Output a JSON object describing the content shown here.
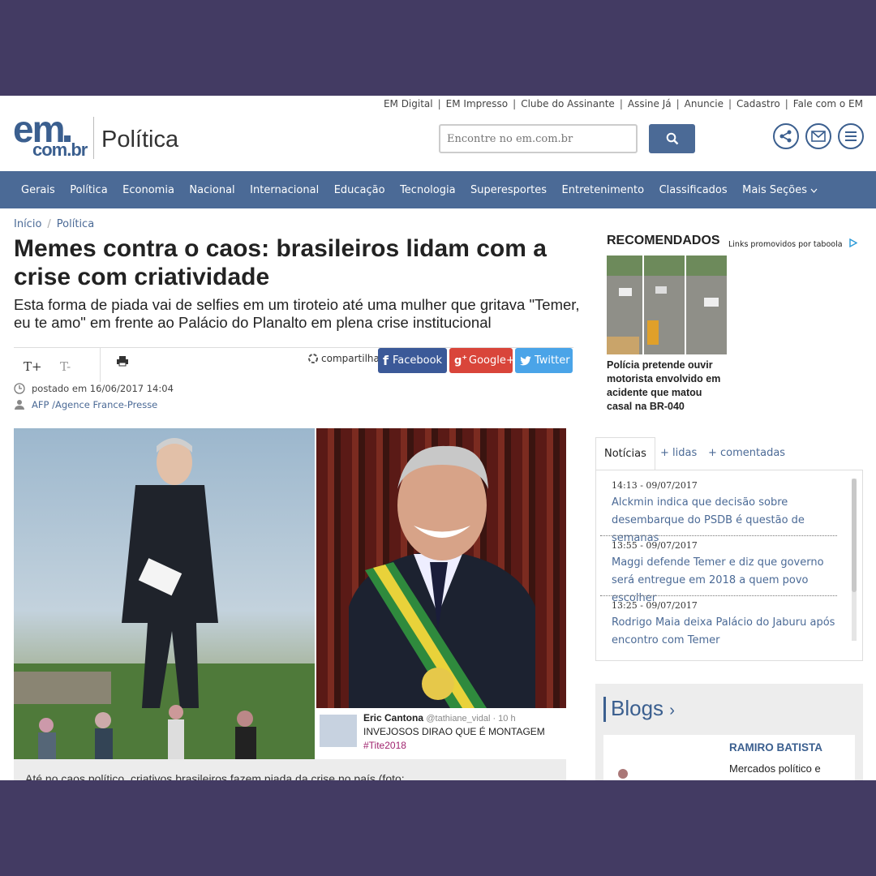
{
  "header": {
    "top_links": [
      "EM Digital",
      "EM Impresso",
      "Clube do Assinante",
      "Assine Já",
      "Anuncie",
      "Cadastro",
      "Fale com o EM"
    ],
    "logo_main": "em",
    "logo_sub": "com.br",
    "section": "Política",
    "search_placeholder": "Encontre no em.com.br",
    "icons": [
      "share-icon",
      "mail-icon",
      "menu-icon"
    ]
  },
  "nav": [
    "Gerais",
    "Política",
    "Economia",
    "Nacional",
    "Internacional",
    "Educação",
    "Tecnologia",
    "Superesportes",
    "Entretenimento",
    "Classificados",
    "Mais Seções"
  ],
  "article": {
    "breadcrumb": [
      "Início",
      "Política"
    ],
    "headline": "Memes contra o caos: brasileiros lidam com a crise com criatividade",
    "subhead": "Esta forma de piada vai de selfies em um tiroteio até uma mulher que gritava \"Temer, eu te amo\" em frente ao Palácio do Planalto em plena crise institucional",
    "font_up": "T+",
    "font_down": "T-",
    "share_label": "compartilhar:",
    "share_buttons": {
      "facebook": "Facebook",
      "google": "Google+",
      "twitter": "Twitter"
    },
    "posted": "postado em 16/06/2017 14:04",
    "author": "AFP /Agence France-Presse",
    "tweet": {
      "name": "Eric Cantona",
      "handle": "@tathiane_vidal · 10 h",
      "text": "INVEJOSOS DIRAO QUE É MONTAGEM",
      "hashtag": "#Tite2018"
    },
    "caption": "Até no caos político, criativos brasileiros fazem piada da crise no país (foto:"
  },
  "sidebar": {
    "recommended_title": "RECOMENDADOS",
    "recommended_sub": "Links promovidos por taboola",
    "recommended_caption": "Polícia pretende ouvir motorista envolvido em acidente que matou casal na BR-040",
    "tabs": [
      "Notícias",
      "+ lidas",
      "+ comentadas"
    ],
    "news": [
      {
        "time": "14:13 - 09/07/2017",
        "title": "Alckmin indica que decisão sobre desembarque do PSDB é questão de semanas"
      },
      {
        "time": "13:55 - 09/07/2017",
        "title": "Maggi defende Temer e diz que governo será entregue em 2018 a quem povo escolher"
      },
      {
        "time": "13:25 - 09/07/2017",
        "title": "Rodrigo Maia deixa Palácio do Jaburu após encontro com Temer"
      }
    ],
    "blogs_title": "Blogs",
    "blogs_chevron": "›",
    "blog_author": "RAMIRO BATISTA",
    "blog_text": "Mercados político e"
  },
  "colors": {
    "frame": "#433b63",
    "brand": "#4b6a96",
    "facebook": "#3b5998",
    "google": "#d9453a",
    "twitter": "#4aa4e8"
  }
}
